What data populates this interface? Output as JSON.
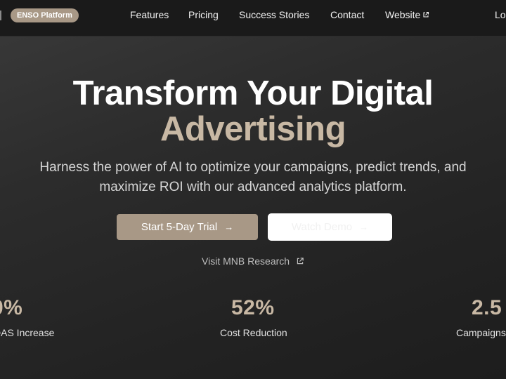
{
  "nav": {
    "brand": "ENSO Platform",
    "links": [
      "Features",
      "Pricing",
      "Success Stories",
      "Contact",
      "Website",
      "Lo"
    ]
  },
  "hero": {
    "title": "Transform Your Digital",
    "title_accent": "Advertising",
    "subtitle": "Harness the power of AI to optimize your campaigns, predict trends, and maximize ROI with our advanced analytics platform."
  },
  "cta": {
    "primary_label": "Start 5-Day Trial",
    "secondary_label": "Watch Demo",
    "research_link": "Visit MNB Research"
  },
  "stats": [
    {
      "value": "0%",
      "label": "DAS Increase"
    },
    {
      "value": "52%",
      "label": "Cost Reduction"
    },
    {
      "value": "2.5",
      "label": "Campaigns"
    }
  ],
  "colors": {
    "accent": "#a89886",
    "accent_text": "#c8b8a4",
    "nav_bg": "#1a1a1a"
  },
  "icons": {
    "external_link": "external-link-icon",
    "arrow_right": "arrow-right-icon"
  }
}
